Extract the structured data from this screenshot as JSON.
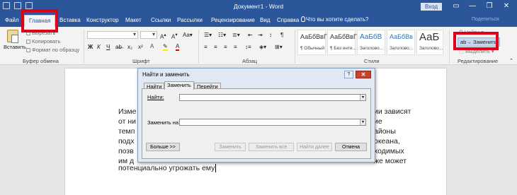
{
  "window": {
    "title": "Документ1 - Word",
    "signin": "Вход",
    "min": "—",
    "restore": "❐",
    "close": "✕"
  },
  "tabs": {
    "file": "Файл",
    "home": "Главная",
    "insert": "Вставка",
    "design": "Конструктор",
    "layout": "Макет",
    "references": "Ссылки",
    "mailings": "Рассылки",
    "review": "Рецензирование",
    "view": "Вид",
    "help": "Справка",
    "tell_me": "Что вы хотите сделать?",
    "share": "Поделиться"
  },
  "ribbon": {
    "clipboard": {
      "paste": "Вставить",
      "cut": "Вырезать",
      "copy": "Копировать",
      "format_painter": "Формат по образцу",
      "label": "Буфер обмена"
    },
    "font": {
      "bold": "Ж",
      "italic": "К",
      "underline": "Ч",
      "label": "Шрифт"
    },
    "paragraph": {
      "label": "Абзац"
    },
    "styles": {
      "label": "Стили",
      "items": [
        {
          "sample": "АаБбВвГг",
          "name": "¶ Обычный"
        },
        {
          "sample": "АаБбВвГг",
          "name": "¶ Без инте..."
        },
        {
          "sample": "АаБбВ",
          "name": "Заголово..."
        },
        {
          "sample": "АаБбВв",
          "name": "Заголово..."
        },
        {
          "sample": "АаБ",
          "name": "Заголово..."
        }
      ]
    },
    "editing": {
      "find": "Найти",
      "replace": "Заменить",
      "select": "Выделить",
      "label": "Редактирование"
    }
  },
  "document": {
    "lines_left": [
      "Изме",
      "от ни",
      "темп",
      "подх",
      "позв",
      "им д"
    ],
    "lines_right": [
      "ии зависят",
      "ие",
      "айоны",
      "океана,",
      "ходимых",
      "же может"
    ],
    "last_line": "потенциально угрожать ему"
  },
  "dialog": {
    "title": "Найти и заменить",
    "help": "?",
    "close": "✕",
    "tabs": {
      "find": "Найти",
      "replace": "Заменить",
      "goto": "Перейти"
    },
    "find_label": "Найти:",
    "find_value": "",
    "replace_label": "Заменить на:",
    "replace_value": "",
    "buttons": {
      "more": "Больше >>",
      "replace": "Заменить",
      "replace_all": "Заменить все",
      "find_next": "Найти далее",
      "cancel": "Отмена"
    }
  }
}
